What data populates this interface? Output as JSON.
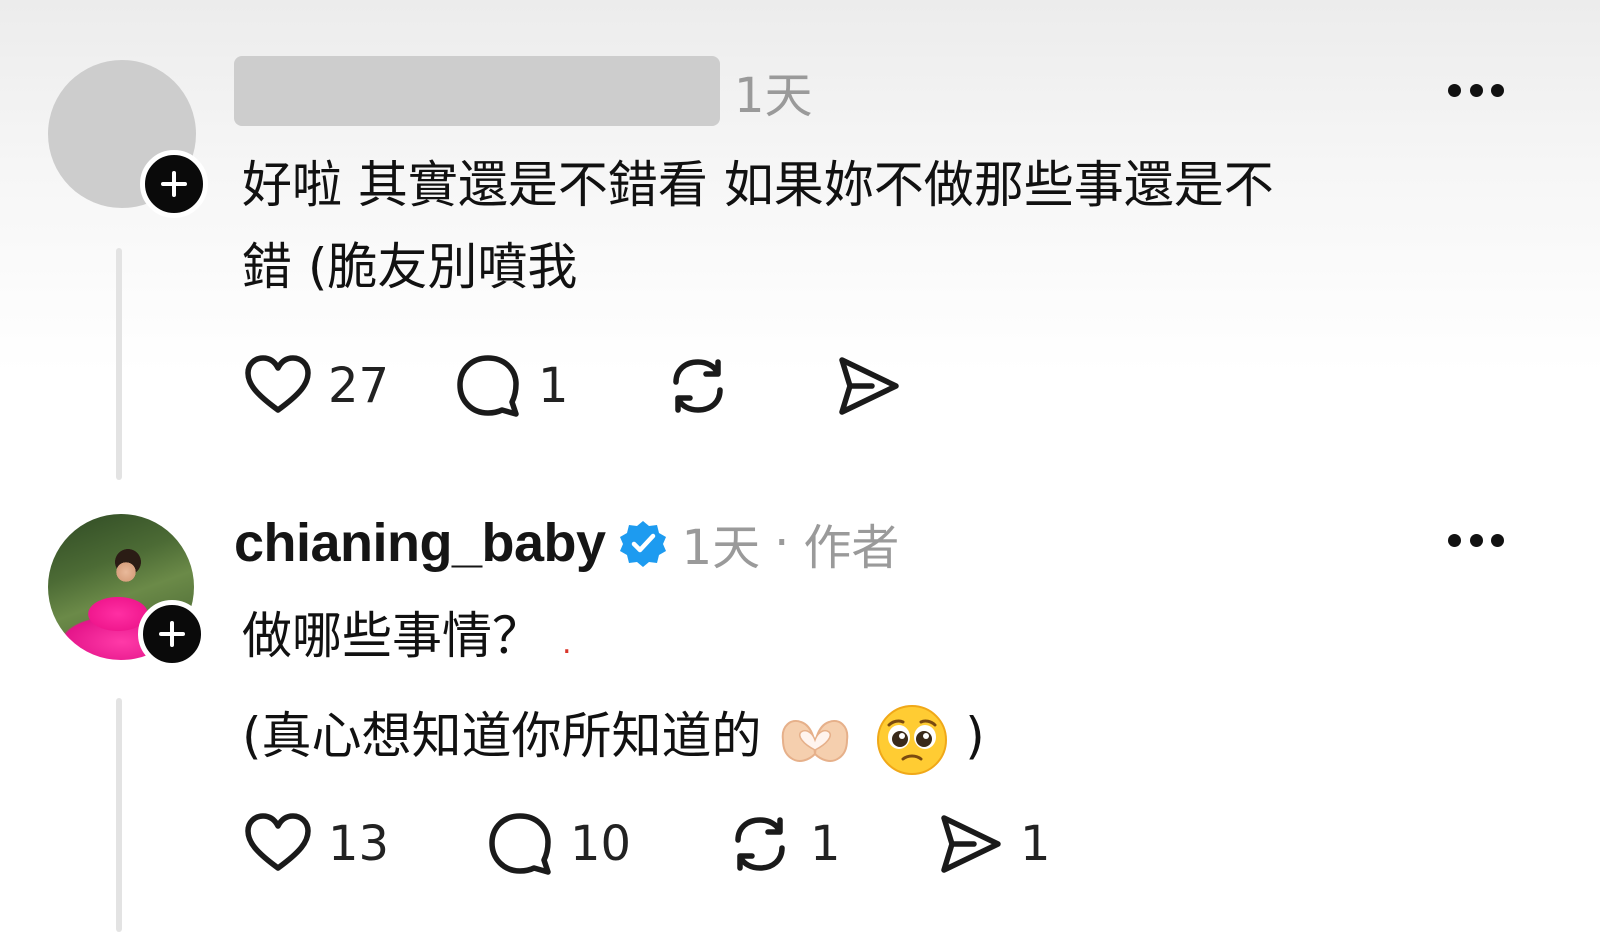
{
  "comments": [
    {
      "author_redacted": true,
      "time": "1天",
      "text_lines": [
        "好啦 其實還是不錯看 如果妳不做那些事還是不",
        "錯 (脆友別噴我"
      ],
      "actions": {
        "likes": "27",
        "replies": "1",
        "reposts": "",
        "shares": ""
      }
    },
    {
      "author": "chianing_baby",
      "verified": true,
      "time": "1天",
      "separator": "·",
      "role": "作者",
      "text_lines": [
        "做哪些事情？",
        "(真心想知道你所知道的"
      ],
      "text_line_2_close": ")",
      "red_dot": ".",
      "actions": {
        "likes": "13",
        "replies": "10",
        "reposts": "1",
        "shares": "1"
      }
    }
  ],
  "icons": {
    "more": "more-horizontal-icon",
    "like": "heart-icon",
    "reply": "comment-bubble-icon",
    "repost": "repost-arrows-icon",
    "share": "send-plane-icon",
    "follow": "plus-icon",
    "verified": "verified-badge-icon"
  },
  "colors": {
    "verified": "#1d9bf0",
    "meta_gray": "#9a9a9a",
    "avatar_placeholder": "#cdcdcd"
  }
}
